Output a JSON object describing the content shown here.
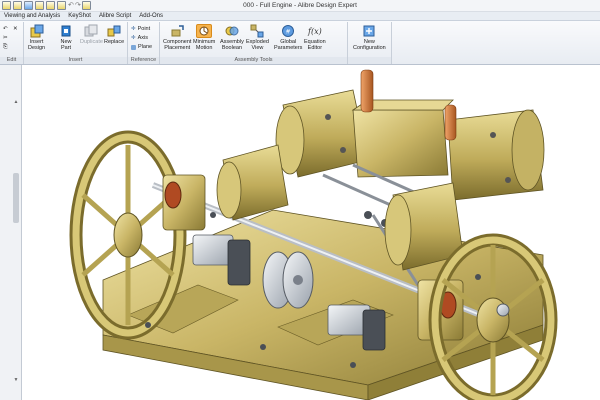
{
  "window": {
    "title": "000 - Full Engine - Alibre Design Expert"
  },
  "menu": {
    "items": [
      "Viewing and Analysis",
      "KeyShot",
      "Alibre Script",
      "Add-Ons"
    ]
  },
  "ribbon": {
    "groups": {
      "edit": "Edit",
      "insert": "Insert",
      "reference": "Reference",
      "assembly_tools": "Assembly Tools"
    },
    "buttons": {
      "insert_design": "Insert\nDesign",
      "new_part": "New\nPart",
      "duplicate": "Duplicate",
      "replace": "Replace",
      "point": "Point",
      "axis": "Axis",
      "plane": "Plane",
      "component_placement": "Component\nPlacement",
      "minimum_motion": "Minimum\nMotion",
      "assembly_boolean": "Assembly\nBoolean",
      "exploded_view": "Exploded\nView",
      "global_parameters": "Global\nParameters",
      "equation_editor": "Equation\nEditor",
      "new_configuration": "New\nConfiguration"
    },
    "equation_icon_text": "f(x)"
  },
  "colors": {
    "brass": "#c9b566",
    "brass_dark": "#8a7a35",
    "steel": "#c8cdd3",
    "copper": "#d07a3a",
    "accent": "#f6b34d"
  },
  "icons": [
    "save-icon",
    "undo-icon",
    "redo-icon",
    "insert-design-icon",
    "new-part-icon",
    "duplicate-icon",
    "replace-icon",
    "point-icon",
    "axis-icon",
    "plane-icon",
    "component-placement-icon",
    "minimum-motion-icon",
    "assembly-boolean-icon",
    "exploded-view-icon",
    "global-parameters-icon",
    "equation-editor-icon",
    "new-configuration-icon"
  ]
}
